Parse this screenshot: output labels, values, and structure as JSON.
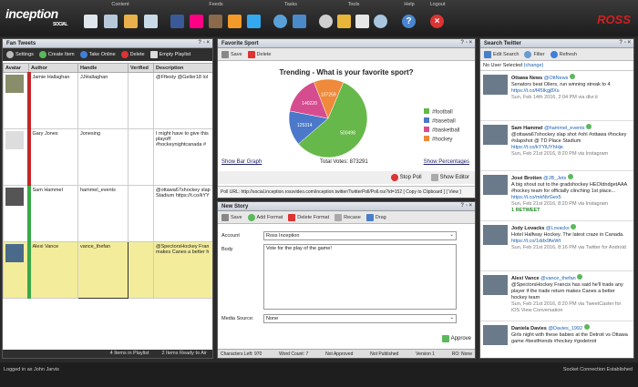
{
  "app": {
    "logo_text": "inception",
    "logo_sub": "SOCIAL",
    "brand": "ROSS"
  },
  "toolbar_groups": [
    {
      "label": "Content"
    },
    {
      "label": "Feeds"
    },
    {
      "label": "Tasks"
    },
    {
      "label": "Tools"
    },
    {
      "label": "Help"
    },
    {
      "label": "Logout"
    }
  ],
  "fan_tweets": {
    "title": "Fan Tweets",
    "tools": {
      "settings": "Settings",
      "create": "Create Item",
      "online": "Take Online",
      "delete": "Delete",
      "empty": "Empty Playlist"
    },
    "columns": [
      "Avatar",
      "Author",
      "Handle",
      "Verified",
      "Description"
    ],
    "rows": [
      {
        "author": "Jamie Hallaghan",
        "handle": "JJHallaghan",
        "desc": "@Fftesty @Geller18 lol"
      },
      {
        "author": "Gary Jones",
        "handle": "Jonesing",
        "desc": "I might have to give this playoff #hockeynightcanada #"
      },
      {
        "author": "Sam Hammel",
        "handle": "hammel_events",
        "desc": "@ottawa67shockey slap Stadium https://t.co/kYY"
      },
      {
        "author": "Alexi Vance",
        "handle": "vance_thefan",
        "desc": "@SpectorsHockey Fran makes Canes a better h"
      }
    ],
    "status_items": "4 Items in Playlist",
    "status_ready": "2 Items Ready to Air"
  },
  "favorite_sport": {
    "title": "Favorite Sport",
    "save": "Save",
    "delete": "Delete",
    "show_bar": "Show Bar Graph",
    "total_votes": "Total Votes: 873291",
    "show_pct": "Show Percentages",
    "stop_poll": "Stop Poll",
    "show_editor": "Show Editor",
    "poll_url": "Poll URL: http://social.inception.rossvideo.com/inception.twitter/TwitterPoll/Poll.rss?id=152",
    "copy": "[ Copy to Clipboard ]",
    "view": "[ View ]"
  },
  "chart_data": {
    "type": "pie",
    "title": "Trending - What is your favorite sport?",
    "categories": [
      "#football",
      "#baseball",
      "#basketball",
      "#hockey"
    ],
    "values": [
      500498,
      125314,
      140220,
      107259
    ],
    "colors": [
      "#67b84a",
      "#4b78c8",
      "#d64d8f",
      "#ee8a3a"
    ]
  },
  "new_story": {
    "title": "New Story",
    "tools": {
      "save": "Save",
      "add_format": "Add Format",
      "delete_format": "Delete Format",
      "recase": "Recase",
      "drag": "Drag"
    },
    "account_label": "Account",
    "account_value": "Ross Inception",
    "body_label": "Body",
    "body_value": "Vote for the play of the game!",
    "media_label": "Media Source:",
    "media_value": "None",
    "approve": "Approve",
    "status": [
      "Characters Left: 970",
      "Word Count: 7",
      "Not Approved",
      "Not Published",
      "Version 1",
      "RO: None"
    ]
  },
  "search_twitter": {
    "title": "Search Twitter",
    "tools": {
      "edit": "Edit Search",
      "filter": "Filter",
      "refresh": "Refresh"
    },
    "selected_note": "No User Selected",
    "change": "(change)",
    "tweets": [
      {
        "name": "Ottawa News",
        "handle": "@OttNews",
        "text": "Senators beat Oilers, run winning streak to 4",
        "link": "https://t.co/f45Ikgj8Xs",
        "meta": "Sun, Feb 14th 2016, 2:04 PM via dlvr.it"
      },
      {
        "name": "Sam Hammel",
        "handle": "@hammel_events",
        "text": "@ottawa67shockey slap shot #ohl #ottawa #hockey #slapshot @ TD Place Stadium",
        "link": "https://t.co/kYYiUYhHje",
        "meta": "Sun, Feb 21st 2016, 8:20 PM via Instagram"
      },
      {
        "name": "José Brotten",
        "handle": "@JB_Jets",
        "text": "A big shout out to the gradshockey HEOIdndgetAAA #hockey team for officially clinching 1st place...",
        "link": "https://t.co/mkNtrGex5",
        "meta": "Sun, Feb 21st 2016, 8:20 PM via Instagram",
        "extra": "1 RETWEET"
      },
      {
        "name": "Jody Lovacks",
        "handle": "@Lovacks",
        "text": "Hotel Halfway Hockey. The latest craze in Canada.",
        "link": "https://t.co/1ddx9fwWt",
        "meta": "Sun, Feb 21st 2016, 8:16 PM via Twitter for Android"
      },
      {
        "name": "Alexi Vance",
        "handle": "@vance_thefan",
        "text": "@SpectorsHockey Francis has said he'll trade any player if the trade return makes Canes a better hockey team",
        "link": "",
        "meta": "Sun, Feb 21st 2016, 8:20 PM via TweetCaster for iOS View Conversation"
      },
      {
        "name": "Daniela Davies",
        "handle": "@Davies_1992",
        "text": "Girls night with these babies at the Detroit vs Ottawa game #bestfriends #hockey #godetroit",
        "link": "",
        "meta": ""
      }
    ]
  },
  "bottom": {
    "login": "Logged in as John Jarvis",
    "socket": "Socket Connection Established"
  }
}
